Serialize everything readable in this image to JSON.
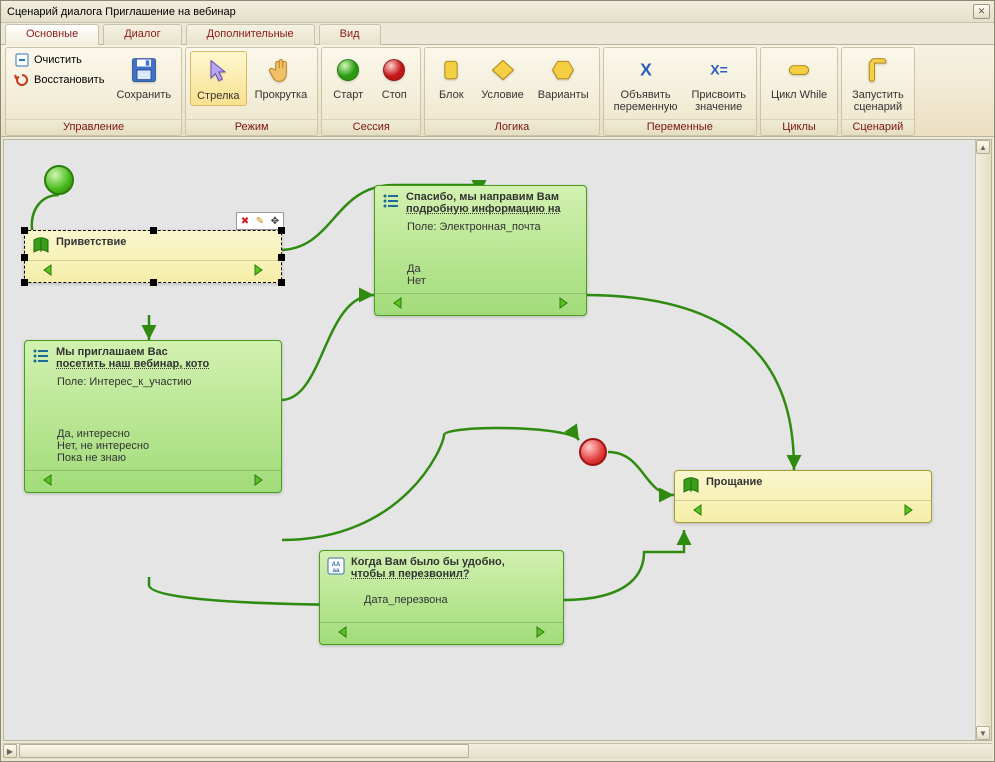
{
  "window": {
    "title": "Сценарий диалога Приглашение на вебинар"
  },
  "tabs": [
    {
      "id": "main",
      "label": "Основные",
      "active": true
    },
    {
      "id": "dialog",
      "label": "Диалог"
    },
    {
      "id": "extra",
      "label": "Дополнительные"
    },
    {
      "id": "view",
      "label": "Вид"
    }
  ],
  "ribbon": {
    "groups": {
      "manage": {
        "label": "Управление",
        "clear": "Очистить",
        "restore": "Восстановить",
        "save": "Сохранить"
      },
      "mode": {
        "label": "Режим",
        "arrow": "Стрелка",
        "scroll": "Прокрутка"
      },
      "session": {
        "label": "Сессия",
        "start": "Старт",
        "stop": "Стоп"
      },
      "logic": {
        "label": "Логика",
        "block": "Блок",
        "condition": "Условие",
        "variants": "Варианты"
      },
      "variables": {
        "label": "Переменные",
        "declare_l1": "Объявить",
        "declare_l2": "переменную",
        "assign_l1": "Присвоить",
        "assign_l2": "значение"
      },
      "loops": {
        "label": "Циклы",
        "while": "Цикл While"
      },
      "scenario": {
        "label": "Сценарий",
        "run_l1": "Запустить",
        "run_l2": "сценарий"
      }
    }
  },
  "nodes": {
    "greet": {
      "title": "Приветствие"
    },
    "invite": {
      "title_l1": "Мы приглашаем Вас",
      "title_l2": "посетить наш вебинар, кото",
      "field": "Поле: Интерес_к_участию",
      "opt1": "Да, интересно",
      "opt2": "Нет, не интересно",
      "opt3": "Пока не знаю"
    },
    "thanks": {
      "title_l1": "Спасибо, мы направим Вам",
      "title_l2": "подробную информацию на",
      "field": "Поле: Электронная_почта",
      "opt1": "Да",
      "opt2": "Нет"
    },
    "callback": {
      "title_l1": "Когда Вам было бы удобно,",
      "title_l2": "чтобы я перезвонил?",
      "field": "Дата_перезвона"
    },
    "bye": {
      "title": "Прощание"
    }
  }
}
